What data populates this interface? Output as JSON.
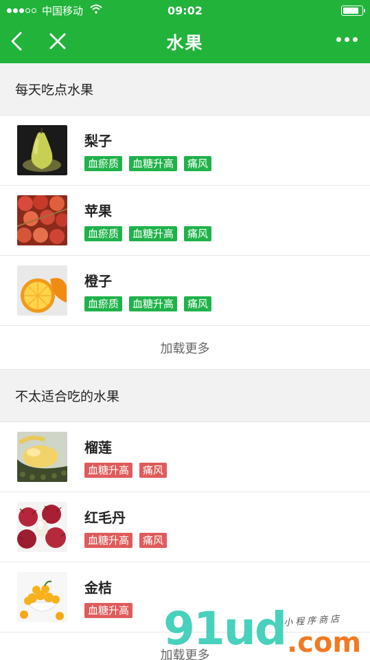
{
  "status": {
    "carrier": "中国移动",
    "time": "09:02"
  },
  "nav": {
    "title": "水果"
  },
  "sections": [
    {
      "title": "每天吃点水果",
      "items": [
        {
          "name": "梨子",
          "image": "pear",
          "tags": [
            "血瘀质",
            "血糖升高",
            "痛风"
          ]
        },
        {
          "name": "苹果",
          "image": "apple",
          "tags": [
            "血瘀质",
            "血糖升高",
            "痛风"
          ]
        },
        {
          "name": "橙子",
          "image": "orange",
          "tags": [
            "血瘀质",
            "血糖升高",
            "痛风"
          ]
        }
      ],
      "tag_color": "#1fb24a",
      "load_more": "加载更多"
    },
    {
      "title": "不太适合吃的水果",
      "items": [
        {
          "name": "榴莲",
          "image": "durian",
          "tags": [
            "血糖升高",
            "痛风"
          ]
        },
        {
          "name": "红毛丹",
          "image": "rambutan",
          "tags": [
            "血糖升高",
            "痛风"
          ]
        },
        {
          "name": "金桔",
          "image": "kumquat",
          "tags": [
            "血糖升高"
          ]
        }
      ],
      "tag_color": "#e05b5b",
      "load_more": "加载更多"
    }
  ],
  "watermark": {
    "brand": "91ud",
    "domain": ".com",
    "tagline": "小程序商店"
  },
  "colors": {
    "header_green": "#21b33a",
    "tag_green": "#1fb24a",
    "tag_red": "#e05b5b"
  },
  "icons": [
    "signal-icon",
    "wifi-icon",
    "battery-icon",
    "back-icon",
    "close-icon",
    "more-icon"
  ]
}
